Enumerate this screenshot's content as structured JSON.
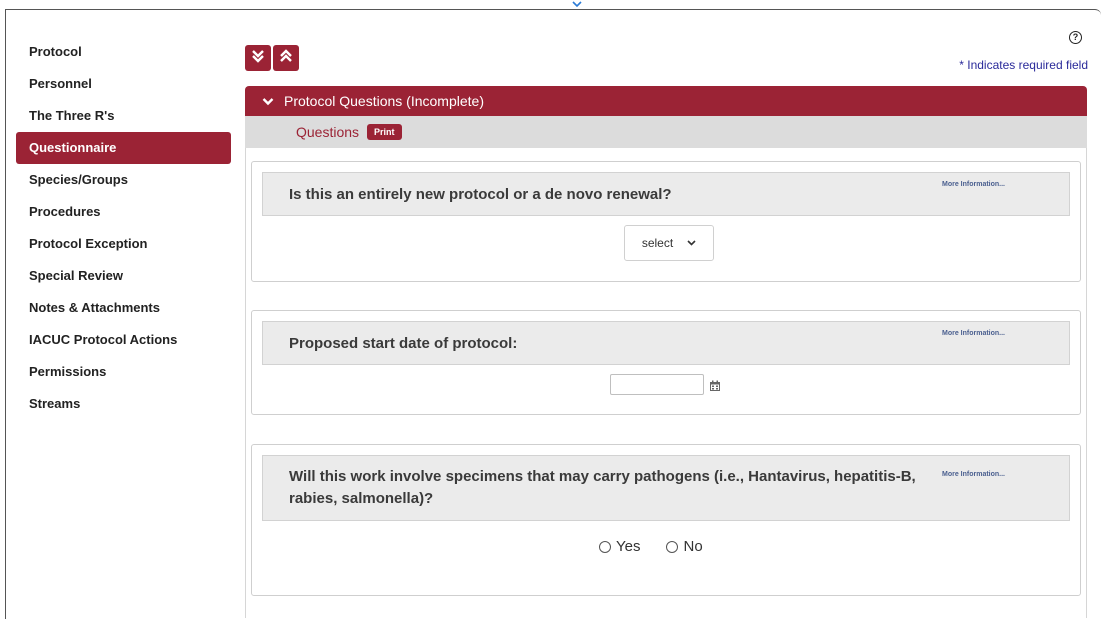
{
  "sidebar": {
    "items": [
      {
        "label": "Protocol",
        "active": false
      },
      {
        "label": "Personnel",
        "active": false
      },
      {
        "label": "The Three R's",
        "active": false
      },
      {
        "label": "Questionnaire",
        "active": true
      },
      {
        "label": "Species/Groups",
        "active": false
      },
      {
        "label": "Procedures",
        "active": false
      },
      {
        "label": "Protocol Exception",
        "active": false
      },
      {
        "label": "Special Review",
        "active": false
      },
      {
        "label": "Notes & Attachments",
        "active": false
      },
      {
        "label": "IACUC Protocol Actions",
        "active": false
      },
      {
        "label": "Permissions",
        "active": false
      },
      {
        "label": "Streams",
        "active": false
      }
    ]
  },
  "header": {
    "required_note": "* Indicates required field",
    "help_icon": "?"
  },
  "panel": {
    "title": "Protocol Questions (Incomplete)",
    "questions_label": "Questions",
    "print_label": "Print"
  },
  "questions": {
    "q1": {
      "text": "Is this an entirely new protocol or a de novo renewal?",
      "more_info": "More Information...",
      "select_value": "select"
    },
    "q2": {
      "text": "Proposed start date of protocol:",
      "more_info": "More Information...",
      "date_value": ""
    },
    "q3": {
      "text": "Will this work involve specimens that may carry pathogens (i.e., Hantavirus, hepatitis-B, rabies, salmonella)?",
      "more_info": "More Information...",
      "option_yes": "Yes",
      "option_no": "No"
    }
  },
  "colors": {
    "accent": "#9b2335",
    "link": "#2a2a9a",
    "subbar": "#dcdcdc"
  }
}
